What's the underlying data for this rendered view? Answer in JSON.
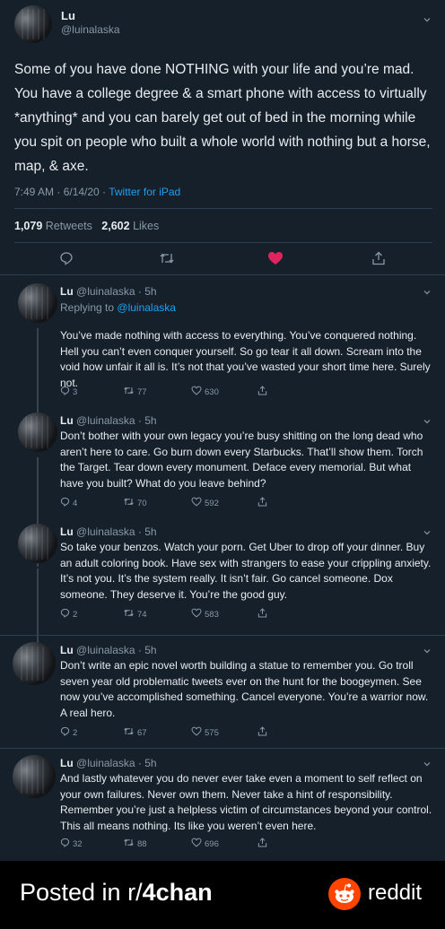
{
  "main_tweet": {
    "display_name": "Lu",
    "handle": "@luinalaska",
    "text": "Some of you have done NOTHING with your life and you’re mad. You have a college degree & a smart phone with access to virtually *anything* and you can barely get out of bed in the morning while you spit on people who built a whole world with nothing but a horse, map, & axe.",
    "timestamp": "7:49 AM · 6/14/20 ·",
    "source": "Twitter for iPad",
    "retweets_count": "1,079",
    "retweets_label": "Retweets",
    "likes_count": "2,602",
    "likes_label": "Likes",
    "like_color": "#e0245e"
  },
  "replies": [
    {
      "header": "Lu",
      "meta": "@luinalaska · 5h",
      "replying_prefix": "Replying to",
      "replying_handle": "@luinalaska",
      "text": "You’ve made nothing with access to everything. You’ve conquered nothing. Hell you can’t even conquer yourself. So go tear it all down. Scream into the void how unfair it all is. It’s not that you’ve wasted your short time here. Surely not.",
      "replies": "3",
      "retweets": "77",
      "likes": "630"
    },
    {
      "header": "Lu",
      "meta": "@luinalaska · 5h",
      "text": "Don’t bother with your own legacy you’re busy shitting on the long dead who aren’t here to care. Go burn down every Starbucks. That’ll show them. Torch the Target. Tear down every monument. Deface every memorial. But what have you built? What do you leave behind?",
      "replies": "4",
      "retweets": "70",
      "likes": "592"
    },
    {
      "header": "Lu",
      "meta": "@luinalaska · 5h",
      "text": "So take your benzos. Watch your porn. Get Uber to drop off your dinner. Buy an adult coloring book. Have sex with strangers to ease your crippling anxiety. It’s not you. It’s the system really. It isn’t fair. Go cancel someone. Dox someone. They deserve it. You’re the good guy.",
      "replies": "2",
      "retweets": "74",
      "likes": "583"
    },
    {
      "header": "Lu",
      "meta": "@luinalaska · 5h",
      "text": "Don’t write an epic novel worth building a statue to remember you. Go troll seven year old problematic tweets ever on the hunt for the boogeymen. See now you’ve accomplished something. Cancel everyone. You’re a warrior now. A real hero.",
      "replies": "2",
      "retweets": "67",
      "likes": "575"
    },
    {
      "header": "Lu",
      "meta": "@luinalaska · 5h",
      "text": "And lastly whatever you do never ever take even a moment to self reflect on your own failures. Never own them. Never take a hint of responsibility. Remember you’re just a helpless victim of circumstances beyond your control. This all means nothing. Its like you weren’t even here.",
      "replies": "32",
      "retweets": "88",
      "likes": "696"
    }
  ],
  "footer": {
    "prefix": "Posted in r/",
    "subreddit": "4chan",
    "brand": "reddit",
    "brand_color": "#ff4500"
  }
}
